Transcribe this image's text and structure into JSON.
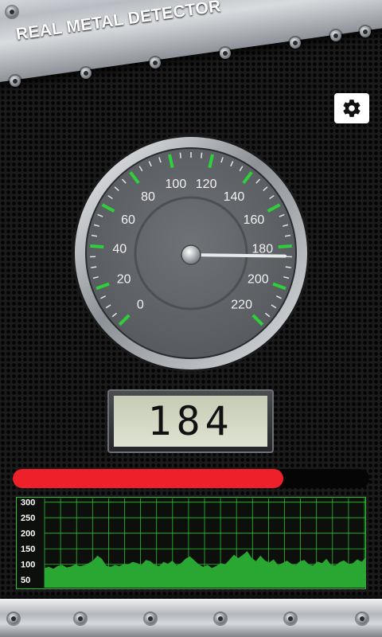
{
  "app": {
    "title": "REAL METAL DETECTOR"
  },
  "settings": {
    "icon": "gear-icon"
  },
  "gauge": {
    "labels": [
      "0",
      "20",
      "40",
      "60",
      "80",
      "100",
      "120",
      "140",
      "160",
      "180",
      "200",
      "220"
    ],
    "min": 0,
    "max": 220,
    "value": 184
  },
  "reading": {
    "display": "184"
  },
  "signal": {
    "level_fraction": 0.76,
    "color": "#ee2029"
  },
  "graph": {
    "y_labels": [
      "300",
      "250",
      "200",
      "150",
      "100",
      "50"
    ],
    "grid_color": "#29c22d",
    "fill_color": "#2aa633",
    "samples": [
      88,
      92,
      86,
      95,
      98,
      90,
      93,
      100,
      94,
      97,
      104,
      112,
      128,
      118,
      96,
      92,
      98,
      94,
      102,
      100,
      108,
      104,
      98,
      114,
      110,
      99,
      94,
      108,
      102,
      112,
      97,
      104,
      118,
      126,
      113,
      100,
      92,
      98,
      88,
      95,
      104,
      100,
      115,
      131,
      120,
      130,
      142,
      121,
      110,
      128,
      113,
      106,
      116,
      98,
      104,
      112,
      102,
      98,
      110,
      114,
      100,
      96,
      109,
      104,
      118,
      99,
      96,
      107,
      113,
      101,
      104,
      116,
      108,
      124
    ]
  },
  "colors": {
    "tick_major": "#2ecf3a",
    "needle": "#e9eaec"
  }
}
